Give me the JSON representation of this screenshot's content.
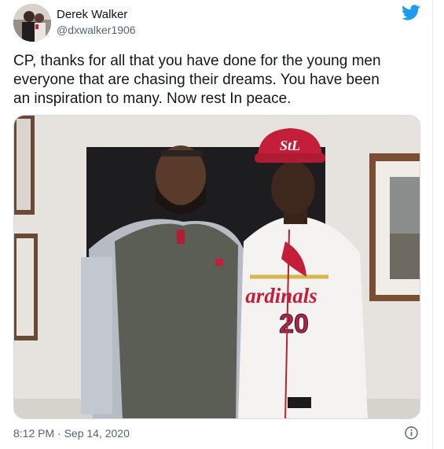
{
  "author": {
    "name": "Derek Walker",
    "handle": "@dxwalker1906"
  },
  "tweet": {
    "lines": [
      "CP, thanks for all that you have done for the young men",
      "everyone that are chasing their dreams.  You have been",
      "an inspiration to many.  Now rest In peace."
    ],
    "timestamp": "8:12 PM · Sep 14, 2020"
  },
  "photo": {
    "jersey_script": "ardinals",
    "jersey_number": "20",
    "cap_logo": "StL"
  },
  "icons": {
    "brand": "twitter-bird-icon",
    "info": "info-icon"
  },
  "colors": {
    "twitter_blue": "#1d9bf0",
    "cardinals_red": "#c41e3a"
  }
}
